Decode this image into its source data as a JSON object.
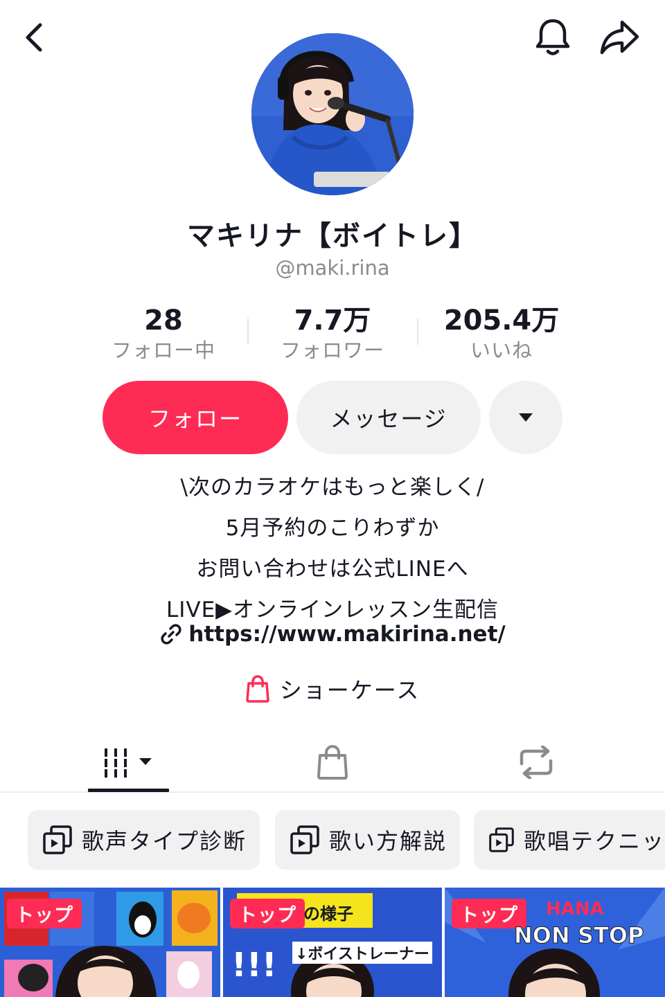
{
  "nav": {
    "back_icon": "chevron-left-icon",
    "notification_icon": "bell-icon",
    "share_icon": "share-icon"
  },
  "profile": {
    "display_name": "マキリナ【ボイトレ】",
    "username": "@maki.rina"
  },
  "stats": [
    {
      "value": "28",
      "label": "フォロー中"
    },
    {
      "value": "7.7万",
      "label": "フォロワー"
    },
    {
      "value": "205.4万",
      "label": "いいね"
    }
  ],
  "actions": {
    "follow_label": "フォロー",
    "message_label": "メッセージ",
    "more_icon": "caret-down-icon"
  },
  "bio": {
    "lines": [
      "\\次のカラオケはもっと楽しく/",
      "5月予約のこりわずか",
      "お問い合わせは公式LINEへ",
      "LIVE▶オンラインレッスン生配信"
    ],
    "link": "https://www.makirina.net/"
  },
  "showcase": {
    "label": "ショーケース"
  },
  "tabs": [
    {
      "icon": "videos-grid-icon",
      "selected": true
    },
    {
      "icon": "shopping-bag-icon",
      "selected": false
    },
    {
      "icon": "repost-icon",
      "selected": false
    }
  ],
  "playlists": [
    {
      "label": "歌声タイプ診断"
    },
    {
      "label": "歌い方解説"
    },
    {
      "label": "歌唱テクニッ"
    }
  ],
  "videos": [
    {
      "badge": "トップ"
    },
    {
      "badge": "トップ",
      "caption_1": "の様子",
      "caption_2": "↓ボイストレーナー",
      "caption_3": "!!!"
    },
    {
      "badge": "トップ",
      "caption_1": "HANA",
      "caption_2": "NON STOP"
    }
  ],
  "colors": {
    "accent": "#fe2c55",
    "text": "#161823",
    "secondary_text": "#8a8b91",
    "button_gray": "#f1f1f2"
  }
}
